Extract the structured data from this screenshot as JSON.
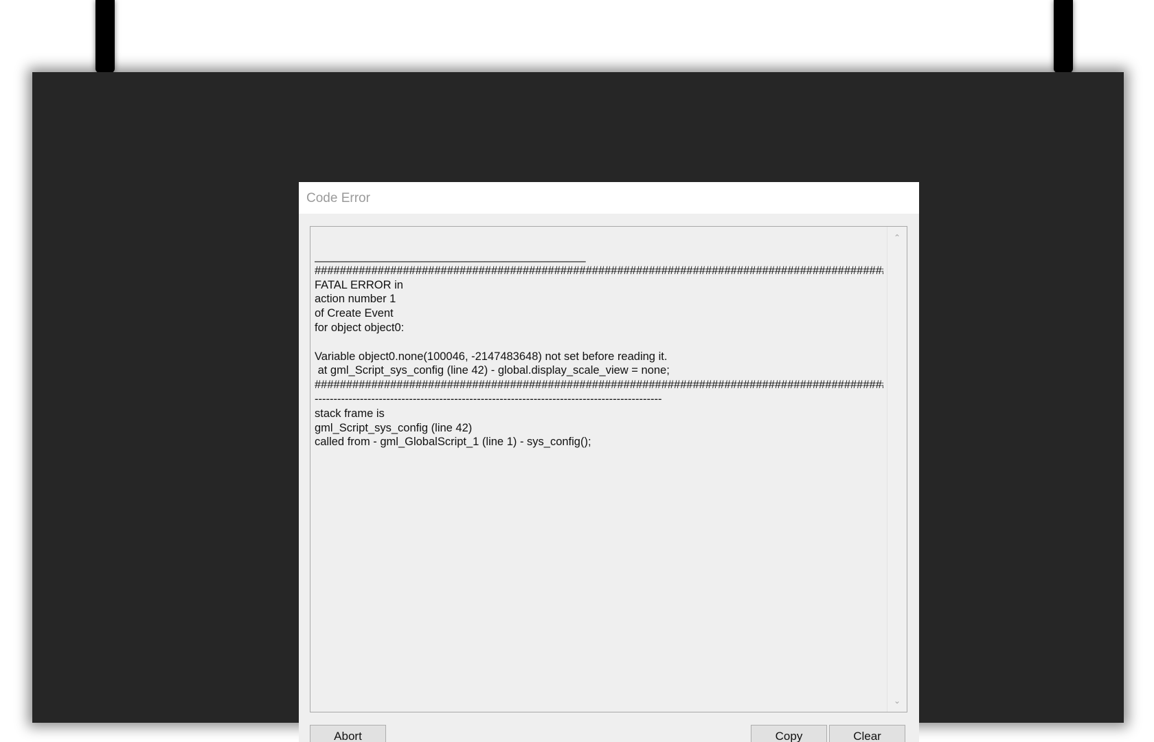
{
  "dialog": {
    "title": "Code Error",
    "log_lines": [
      "___________________________________________",
      "############################################################################################",
      "FATAL ERROR in",
      "action number 1",
      "of Create Event",
      "for object object0:",
      "",
      "Variable object0.none(100046, -2147483648) not set before reading it.",
      " at gml_Script_sys_config (line 42) - global.display_scale_view = none;",
      "############################################################################################",
      "--------------------------------------------------------------------------------------------",
      "stack frame is",
      "gml_Script_sys_config (line 42)",
      "called from - gml_GlobalScript_1 (line 1) - sys_config();"
    ],
    "buttons": {
      "abort": "Abort",
      "copy": "Copy",
      "clear": "Clear"
    }
  },
  "icons": {
    "scroll_up": "chevron-up-icon",
    "scroll_down": "chevron-down-icon"
  },
  "colors": {
    "background": "#ffffff",
    "game_window": "#262626",
    "dialog": "#efefef",
    "title_text": "#9a9a9a"
  }
}
